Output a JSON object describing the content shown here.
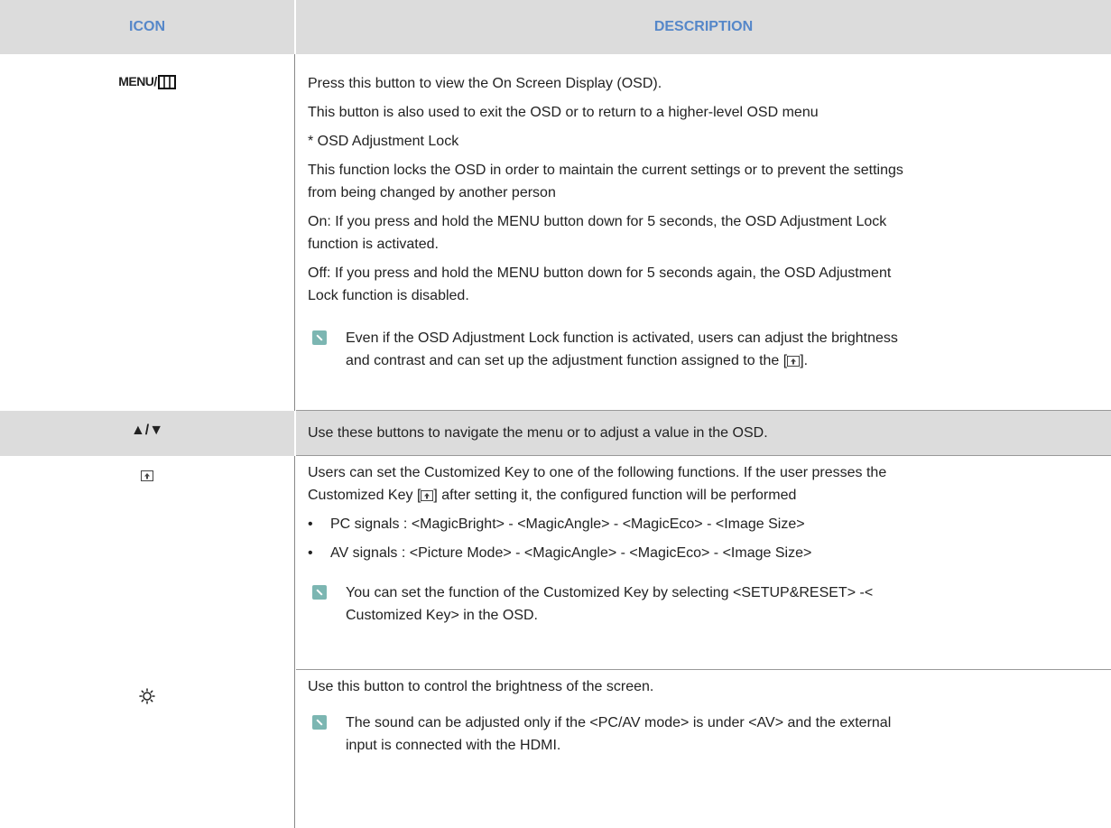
{
  "header": {
    "icon_col": "ICON",
    "desc_col": "DESCRIPTION"
  },
  "rows": {
    "menu": {
      "icon_label": "MENU/",
      "lines": [
        "Press this button to view the On Screen Display (OSD).",
        "This button is also used to exit the OSD or to return to a higher-level OSD menu",
        "* OSD Adjustment Lock",
        "This function locks the OSD in order to maintain the current settings or to prevent the settings",
        "from being changed by another person",
        "On: If you press and hold the MENU button down for 5 seconds, the OSD Adjustment Lock",
        "function is activated.",
        "Off: If you press and hold the MENU button down for 5 seconds again, the OSD Adjustment",
        "Lock function is disabled."
      ],
      "note_line1": "Even if the OSD Adjustment Lock function is activated, users can adjust the brightness",
      "note_line2_pre": "and contrast and can set up the adjustment function assigned to the [",
      "note_line2_post": "]."
    },
    "updown": {
      "icon_label": "▲/▼",
      "text": "Use these buttons to navigate the menu or to adjust a value in the OSD."
    },
    "custom": {
      "line1": "Users can set the Customized Key to one of the following functions. If the user presses the",
      "line2_pre": "Customized Key [",
      "line2_post": "] after setting it, the configured function will be performed",
      "bullets": [
        "PC signals : <MagicBright> - <MagicAngle> - <MagicEco> - <Image Size>",
        "AV signals : <Picture Mode> - <MagicAngle> - <MagicEco> - <Image Size>"
      ],
      "note_line1": "You can set the function of the Customized Key by selecting <SETUP&RESET> -<",
      "note_line2": "Customized Key> in the OSD."
    },
    "brightness": {
      "text": "Use this button to control the brightness of the screen.",
      "note_line1": "The sound can be adjusted only if the <PC/AV mode> is under <AV> and the external",
      "note_line2": "input is connected with the HDMI."
    }
  }
}
